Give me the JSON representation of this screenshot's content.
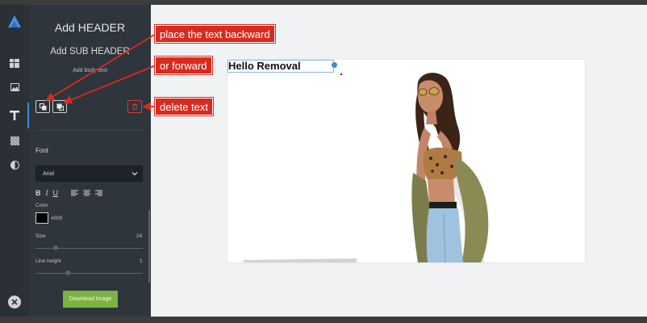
{
  "panel": {
    "header": "Add HEADER",
    "sub_header": "Add SUB HEADER",
    "body_text": "Add body text",
    "font_section_label": "Font",
    "font_family_value": "Arial",
    "color_label": "Color",
    "color_value": "#000",
    "size_label": "Size",
    "size_value": "24",
    "line_height_label": "Line height",
    "line_height_value": "1",
    "download_label": "Download Image"
  },
  "canvas": {
    "text_element": "Hello Removal"
  },
  "callouts": {
    "backward": "place the text backward",
    "forward": "or forward",
    "delete": "delete text"
  },
  "rail_icons": [
    "logo-icon",
    "templates-icon",
    "image-icon",
    "text-icon",
    "pattern-icon",
    "contrast-icon",
    "close-icon"
  ],
  "colors": {
    "accent": "#3d8bd9",
    "callout": "#d72b1f",
    "download": "#7cb342",
    "panel": "#2f353c",
    "rail": "#2b3036"
  }
}
